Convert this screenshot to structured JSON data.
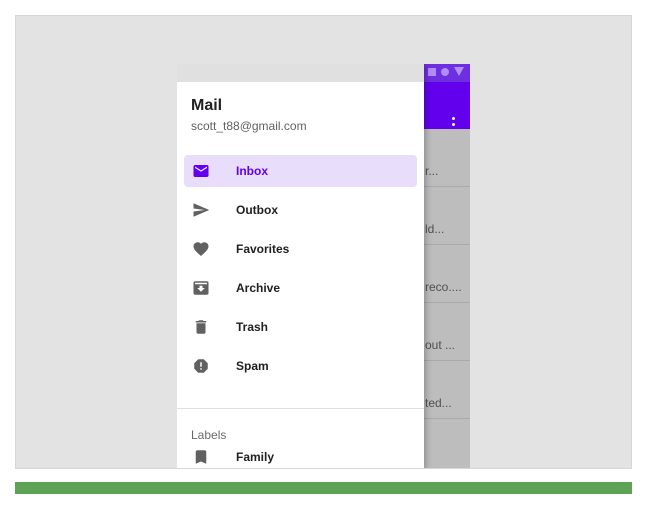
{
  "drawer": {
    "title": "Mail",
    "subtitle": "scott_t88@gmail.com",
    "items": [
      {
        "label": "Inbox",
        "icon": "mail-icon",
        "active": true
      },
      {
        "label": "Outbox",
        "icon": "send-icon"
      },
      {
        "label": "Favorites",
        "icon": "heart-icon"
      },
      {
        "label": "Archive",
        "icon": "archive-icon"
      },
      {
        "label": "Trash",
        "icon": "trash-icon"
      },
      {
        "label": "Spam",
        "icon": "report-icon"
      }
    ],
    "labels_header": "Labels",
    "label_items": [
      {
        "label": "Family",
        "icon": "bookmark-icon"
      }
    ]
  },
  "mail_list": {
    "snippets": [
      "r...",
      "ld...",
      "reco....",
      "out ...",
      "ted..."
    ]
  },
  "colors": {
    "primary": "#6200ee",
    "active_bg": "#e8ddfb"
  }
}
